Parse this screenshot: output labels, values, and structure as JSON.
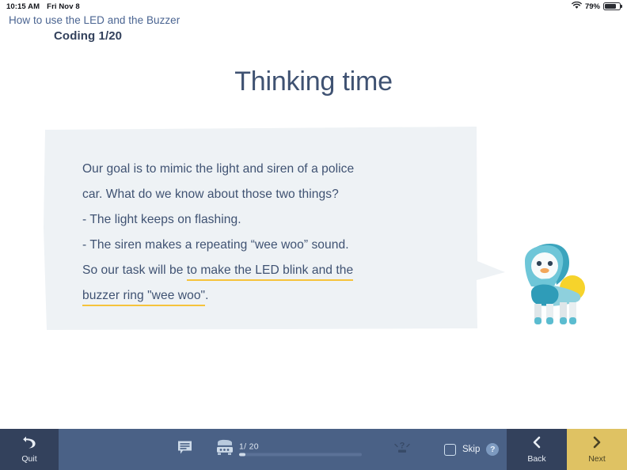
{
  "statusbar": {
    "time": "10:15 AM",
    "date": "Fri Nov 8",
    "battery_percent": "79%",
    "wifi_icon": "wifi-icon",
    "battery_icon": "battery-icon"
  },
  "header": {
    "subject": "How to use the LED and the Buzzer",
    "lesson": "Coding 1/20"
  },
  "slide": {
    "title": "Thinking time",
    "bubble": {
      "lines": [
        {
          "text": "Our goal is to mimic the light and siren of a police",
          "highlight": false
        },
        {
          "text": "car. What do we know about those two things?",
          "highlight": false
        },
        {
          "text": "- The light keeps on flashing.",
          "highlight": false
        },
        {
          "text": "- The siren makes a repeating “wee woo” sound.",
          "highlight": false
        },
        {
          "plain": "So our task will be ",
          "text": "to make the LED blink and the",
          "highlight": true
        },
        {
          "text": "buzzer ring \"wee woo\"",
          "highlight": true,
          "tail": "."
        }
      ]
    },
    "mascot_name": "robot-mascot"
  },
  "toolbar": {
    "quit_label": "Quit",
    "quit_icon": "undo-arrow-icon",
    "comment_icon": "comment-bubble-icon",
    "steps_icon": "robot-device-icon",
    "step_current": "1/",
    "step_total": "20",
    "progress_percent": 5,
    "hint_icon": "hint-question-icon",
    "skip_label": "Skip",
    "skip_checked": false,
    "help_label": "?",
    "back_label": "Back",
    "back_icon": "chevron-left-icon",
    "next_label": "Next",
    "next_icon": "chevron-right-icon"
  },
  "colors": {
    "toolbar_bg": "#4a6186",
    "toolbar_dark": "#33415c",
    "next_accent": "#dfc263",
    "highlight": "#f5c33b",
    "text_blue": "#3f5272",
    "bubble_bg": "#eef2f5",
    "robot_teal": "#5bbcd0",
    "robot_yellow": "#f6d32b"
  }
}
